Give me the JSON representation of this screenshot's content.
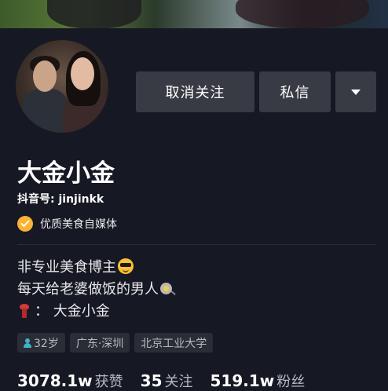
{
  "profile": {
    "display_name": "大金小金",
    "douyin_id": "抖音号: jinjinkk",
    "verification": "优质美食自媒体"
  },
  "actions": {
    "unfollow_label": "取消关注",
    "message_label": "私信",
    "more_icon": "caret-down-icon"
  },
  "bio": {
    "line1": "非专业美食博主",
    "line2": "每天给老婆做饭的男人",
    "line3": "： 大金小金",
    "emojis": [
      "smiling-face-with-sunglasses",
      "cooking-pan",
      "scarf"
    ]
  },
  "tags": [
    {
      "label": "32岁"
    },
    {
      "label": "广东·深圳"
    },
    {
      "label": "北京工业大学"
    }
  ],
  "stats": [
    {
      "value": "3078.1w",
      "label": "获赞"
    },
    {
      "value": "35",
      "label": "关注"
    },
    {
      "value": "519.1w",
      "label": "粉丝"
    }
  ],
  "colors": {
    "background": "#161823",
    "button": "#393b44",
    "verify_badge": "#f9b233",
    "tag_bg": "#2a2c36",
    "muted_text": "#b9bac0"
  }
}
